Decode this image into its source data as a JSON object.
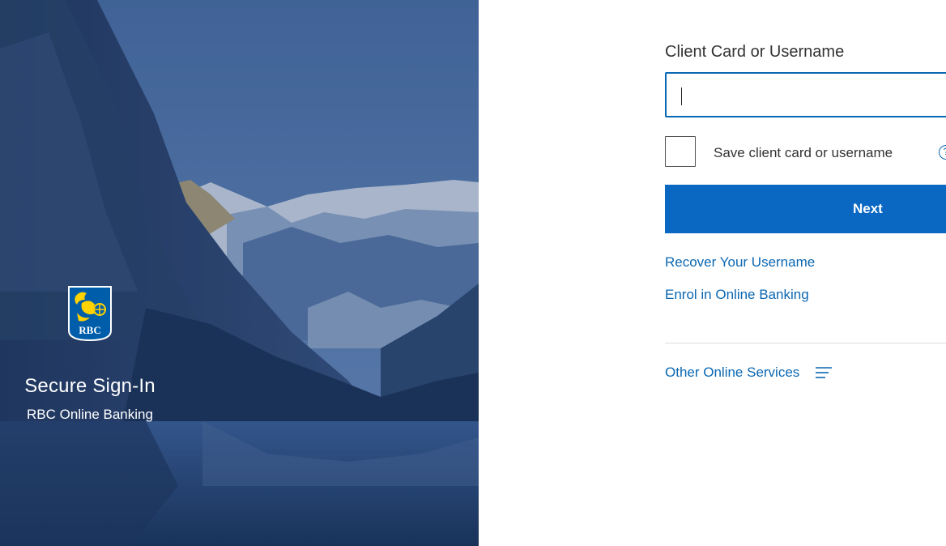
{
  "hero": {
    "logo_text": "RBC",
    "title": "Secure Sign-In",
    "subtitle": "RBC Online Banking"
  },
  "form": {
    "username_label": "Client Card or Username",
    "username_value": "",
    "save_label": "Save client card or username",
    "save_checked": false,
    "help_icon": "help-circle-icon",
    "next_label": "Next",
    "links": {
      "recover_username": "Recover Your Username",
      "enrol": "Enrol in Online Banking",
      "other_services": "Other Online Services"
    },
    "menu_icon": "menu-lines-icon"
  },
  "colors": {
    "brand_blue": "#0a67c2",
    "link_blue": "#0a67b2",
    "logo_gold": "#ffd200",
    "logo_blue": "#005daa"
  }
}
